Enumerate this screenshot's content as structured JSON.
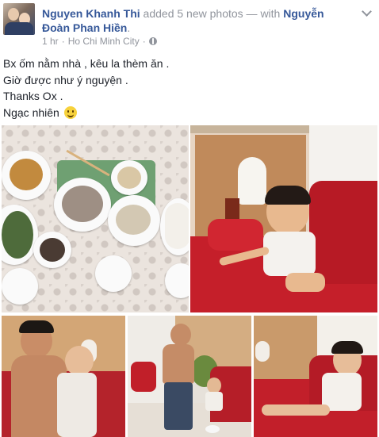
{
  "post": {
    "author": "Nguyen Khanh Thi",
    "action": " added 5 new photos — with ",
    "tagged": "Nguyễn Đoàn Phan Hiền",
    "tagged_end": ".",
    "time": "1 hr",
    "separator1": " · ",
    "location": "Ho Chi Minh City",
    "separator2": " · ",
    "privacy_icon": "globe-icon",
    "menu_icon": "chevron-down-icon"
  },
  "text": {
    "line1": "Bx ốm nằm nhà , kêu la thèm ăn .",
    "line2": "Giờ được như ý nguyện .",
    "line3": "Thanks Ox .",
    "line4": "Ngạc nhiên",
    "emoji": "smile-emoji-icon"
  },
  "colors": {
    "link": "#365899",
    "meta": "#90949c",
    "text": "#1d2129"
  },
  "photos_count": 5
}
